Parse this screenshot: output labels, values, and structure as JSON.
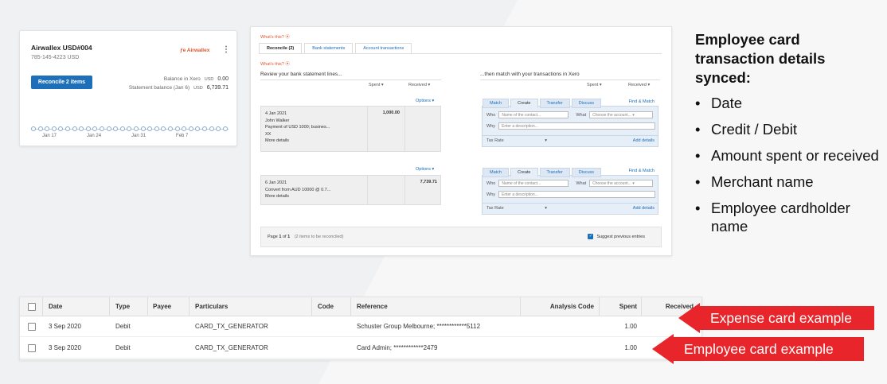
{
  "airwallex_card": {
    "title": "Airwallex USD#004",
    "account_number": "785-145-4223 USD",
    "logo_text": "Airwallex",
    "reconcile_button": "Reconcile 2 items",
    "balance_label": "Balance in Xero",
    "balance_currency": "USD",
    "balance_amount": "0.00",
    "statement_label": "Statement balance (Jan 6)",
    "statement_currency": "USD",
    "statement_amount": "6,739.71",
    "timeline_labels": [
      "Jan 17",
      "Jan 24",
      "Jan 31",
      "Feb 7"
    ]
  },
  "reconcile_panel": {
    "whats_this": "What's this?",
    "tabs": [
      "Reconcile (2)",
      "Bank statements",
      "Account transactions"
    ],
    "whats_this_2": "What's this?",
    "left_heading": "Review your bank statement lines...",
    "right_heading": "...then match with your transactions in Xero",
    "spent_label": "Spent",
    "received_label": "Received",
    "options_label": "Options",
    "xero_tabs": [
      "Match",
      "Create",
      "Transfer",
      "Discuss"
    ],
    "find_match": "Find & Match",
    "who_label": "Who",
    "who_placeholder": "Name of the contact...",
    "what_label": "What",
    "what_placeholder": "Choose the account...",
    "why_label": "Why",
    "why_placeholder": "Enter a description...",
    "tax_rate": "Tax Rate",
    "add_details": "Add details",
    "line1": {
      "date": "4 Jan 2021",
      "payee": "John Walker",
      "desc": "Payment of USD 1000; busines...",
      "ref": "XX",
      "more": "More details",
      "spent": "1,000.00"
    },
    "line2": {
      "date": "6 Jan 2021",
      "desc": "Convert from AUD 10000 @ 0.7...",
      "more": "More details",
      "received": "7,739.71"
    },
    "page_text_prefix": "Page",
    "page_current": "1",
    "page_of": "of",
    "page_total": "1",
    "items_note": "(2 items to be reconciled)",
    "suggest": "Suggest previous entries"
  },
  "right_text": {
    "heading": "Employee card transaction details synced:",
    "bullets": [
      "Date",
      "Credit / Debit",
      "Amount spent or received",
      "Merchant name",
      "Employee cardholder name"
    ]
  },
  "table": {
    "headers": [
      "Date",
      "Type",
      "Payee",
      "Particulars",
      "Code",
      "Reference",
      "Analysis Code",
      "Spent",
      "Received"
    ],
    "rows": [
      [
        "3 Sep 2020",
        "Debit",
        "",
        "CARD_TX_GENERATOR",
        "",
        "Schuster Group Melbourne; ************5112",
        "",
        "1.00",
        ""
      ],
      [
        "3 Sep 2020",
        "Debit",
        "",
        "CARD_TX_GENERATOR",
        "",
        "Card Admin; ************2479",
        "",
        "1.00",
        ""
      ]
    ]
  },
  "callouts": {
    "expense": "Expense card example",
    "employee": "Employee card example"
  },
  "colors": {
    "accent_blue": "#1c6fb8",
    "callout_red": "#e8252a",
    "airwallex_orange": "#e0542e"
  }
}
